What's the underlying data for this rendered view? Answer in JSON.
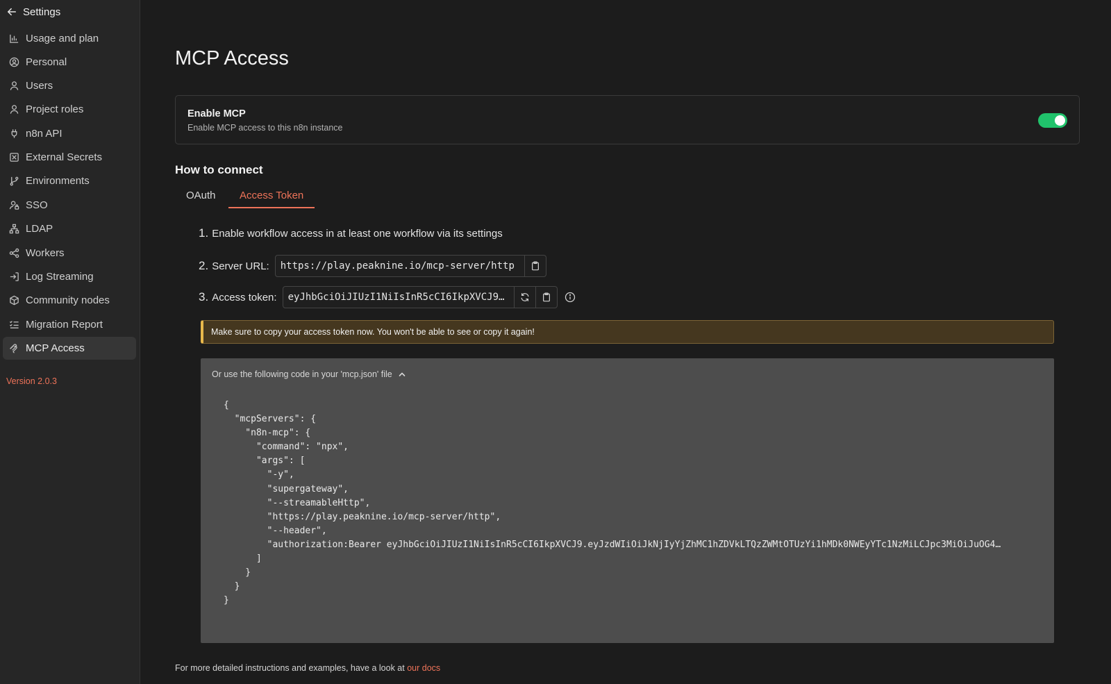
{
  "sidebar": {
    "back_label": "Settings",
    "items": [
      {
        "label": "Usage and plan",
        "icon": "chart-icon"
      },
      {
        "label": "Personal",
        "icon": "user-circle-icon"
      },
      {
        "label": "Users",
        "icon": "user-icon"
      },
      {
        "label": "Project roles",
        "icon": "user-icon"
      },
      {
        "label": "n8n API",
        "icon": "plug-icon"
      },
      {
        "label": "External Secrets",
        "icon": "vault-icon"
      },
      {
        "label": "Environments",
        "icon": "git-branch-icon"
      },
      {
        "label": "SSO",
        "icon": "user-lock-icon"
      },
      {
        "label": "LDAP",
        "icon": "network-icon"
      },
      {
        "label": "Workers",
        "icon": "workflow-icon"
      },
      {
        "label": "Log Streaming",
        "icon": "log-in-icon"
      },
      {
        "label": "Community nodes",
        "icon": "box-icon"
      },
      {
        "label": "Migration Report",
        "icon": "list-check-icon"
      },
      {
        "label": "MCP Access",
        "icon": "mcp-icon",
        "active": true
      }
    ],
    "version": "Version 2.0.3"
  },
  "main": {
    "title": "MCP Access",
    "enable_card": {
      "title": "Enable MCP",
      "subtitle": "Enable MCP access to this n8n instance",
      "enabled": true
    },
    "how_to_connect": "How to connect",
    "tabs": [
      {
        "label": "OAuth",
        "active": false
      },
      {
        "label": "Access Token",
        "active": true
      }
    ],
    "steps": {
      "step1_num": "1.",
      "step1_text": "Enable workflow access in at least one workflow via its settings",
      "step2_num": "2.",
      "step2_label": "Server URL:",
      "server_url": "https://play.peaknine.io/mcp-server/http",
      "step3_num": "3.",
      "step3_label": "Access token:",
      "access_token": "eyJhbGciOiJIUzI1NiIsInR5cCI6IkpXVCJ9…"
    },
    "warning": "Make sure to copy your access token now. You won't be able to see or copy it again!",
    "code_header": "Or use the following code in your 'mcp.json' file",
    "code": "{\n  \"mcpServers\": {\n    \"n8n-mcp\": {\n      \"command\": \"npx\",\n      \"args\": [\n        \"-y\",\n        \"supergateway\",\n        \"--streamableHttp\",\n        \"https://play.peaknine.io/mcp-server/http\",\n        \"--header\",\n        \"authorization:Bearer eyJhbGciOiJIUzI1NiIsInR5cCI6IkpXVCJ9.eyJzdWIiOiJkNjIyYjZhMC1hZDVkLTQzZWMtOTUzYi1hMDk0NWEyYTc1NzMiLCJpc3MiOiJuOG4…\n      ]\n    }\n  }\n}",
    "footer_text": "For more detailed instructions and examples, have a look at ",
    "footer_link": "our docs"
  }
}
